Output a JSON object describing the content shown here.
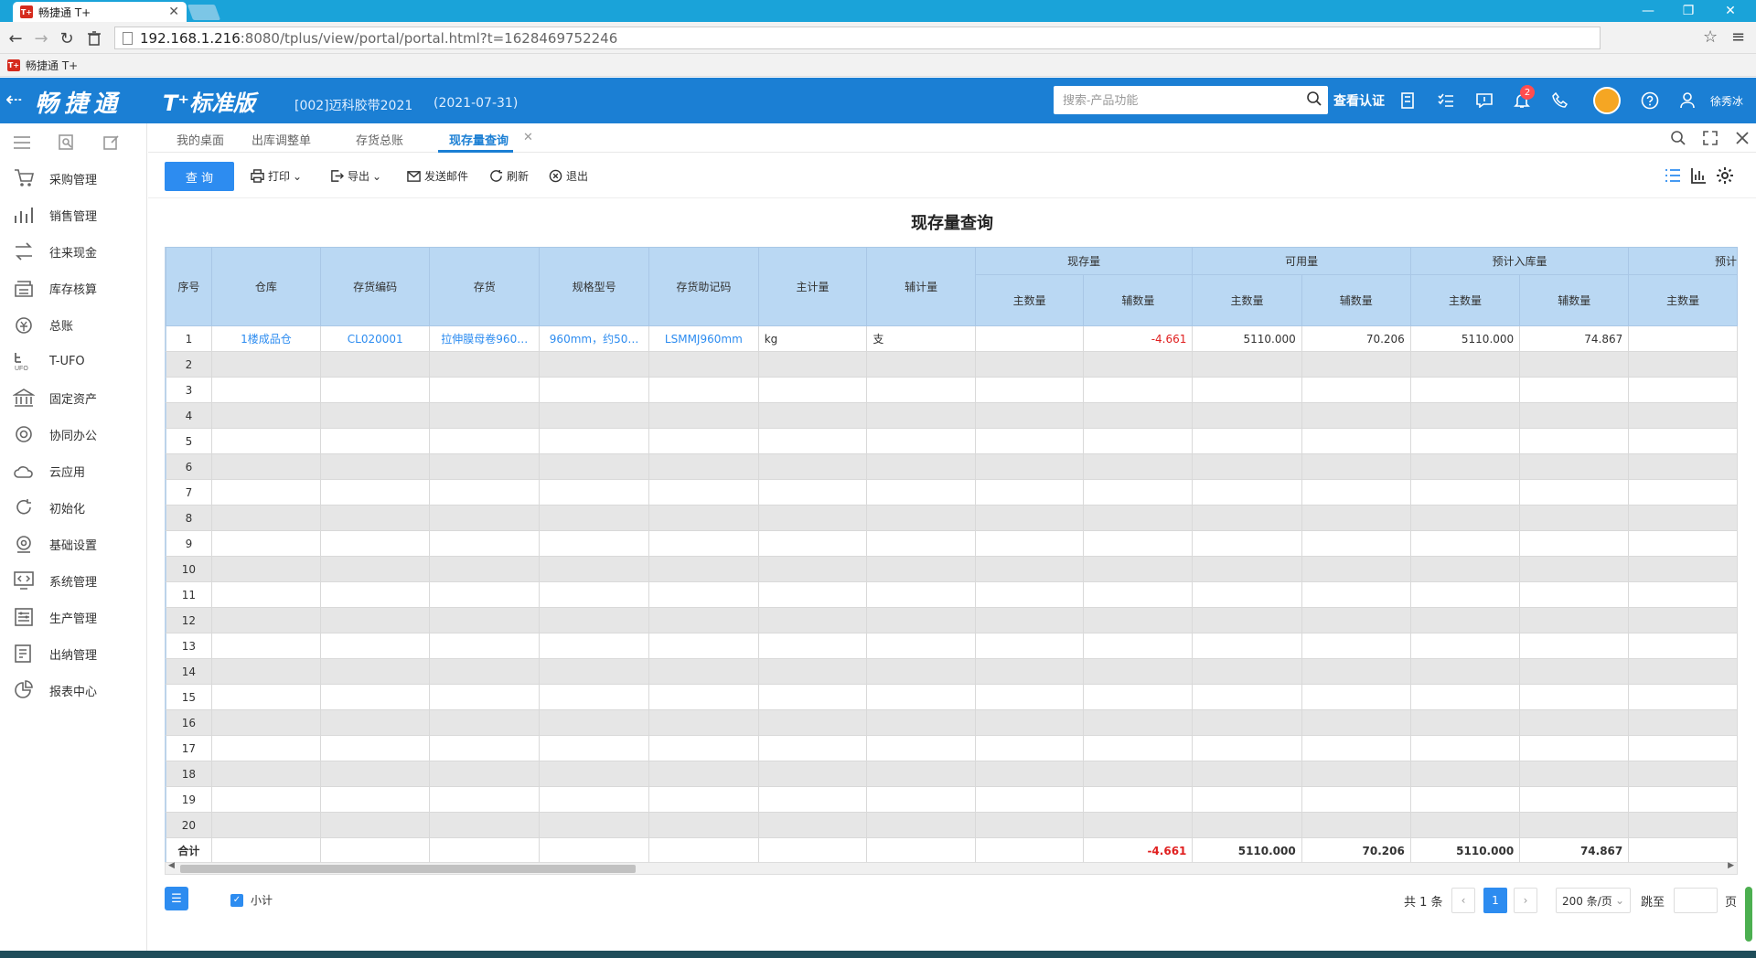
{
  "browser": {
    "tab_title": "畅捷通 T+",
    "tab_favicon": "T+",
    "url_host": "192.168.1.216",
    "url_rest": ":8080/tplus/view/portal/portal.html?t=1628469752246",
    "bookmark_label": "畅捷通 T+"
  },
  "header": {
    "brand": "畅捷通",
    "edition": "T⁺标准版",
    "company": "[002]迈科胶带2021",
    "date": "(2021-07-31)",
    "search_placeholder": "搜索-产品功能",
    "verify_label": "查看认证",
    "notif_count": "2",
    "username": "徐秀冰",
    "accent": "#1b7fd4"
  },
  "sidebar": {
    "items": [
      {
        "label": "采购管理",
        "icon": "purchase-icon"
      },
      {
        "label": "销售管理",
        "icon": "sales-chart-icon"
      },
      {
        "label": "往来现金",
        "icon": "transfer-icon"
      },
      {
        "label": "库存核算",
        "icon": "inventory-icon"
      },
      {
        "label": "总账",
        "icon": "ledger-icon"
      },
      {
        "label": "T-UFO",
        "icon": "ufo-icon"
      },
      {
        "label": "固定资产",
        "icon": "bank-icon"
      },
      {
        "label": "协同办公",
        "icon": "collab-icon"
      },
      {
        "label": "云应用",
        "icon": "cloud-icon"
      },
      {
        "label": "初始化",
        "icon": "refresh-icon"
      },
      {
        "label": "基础设置",
        "icon": "settings-icon"
      },
      {
        "label": "系统管理",
        "icon": "system-icon"
      },
      {
        "label": "生产管理",
        "icon": "production-icon"
      },
      {
        "label": "出纳管理",
        "icon": "cashier-icon"
      },
      {
        "label": "报表中心",
        "icon": "report-pie-icon"
      }
    ]
  },
  "tabs": [
    {
      "label": "我的桌面"
    },
    {
      "label": "出库调整单"
    },
    {
      "label": "存货总账"
    },
    {
      "label": "现存量查询"
    }
  ],
  "toolbar": {
    "query": "查 询",
    "print": "打印",
    "export": "导出",
    "email": "发送邮件",
    "refresh": "刷新",
    "exit": "退出"
  },
  "report": {
    "title": "现存量查询",
    "headers": {
      "index": "序号",
      "warehouse": "仓库",
      "code": "存货编码",
      "item": "存货",
      "spec": "规格型号",
      "mnemonic": "存货助记码",
      "main_unit": "主计量",
      "aux_unit": "辅计量",
      "groups": [
        "现存量",
        "可用量",
        "预计入库量",
        "预计"
      ],
      "main_qty": "主数量",
      "aux_qty": "辅数量"
    },
    "rows": [
      {
        "idx": "1",
        "warehouse": "1楼成品仓",
        "code": "CL020001",
        "item": "拉伸膜母卷960…",
        "spec": "960mm，约50…",
        "mnemonic": "LSMMJ960mm",
        "main_unit": "kg",
        "aux_unit": "支",
        "stock_main": "",
        "stock_aux": "-4.661",
        "avail_main": "5110.000",
        "avail_aux": "70.206",
        "in_main": "5110.000",
        "in_aux": "74.867",
        "next_main": ""
      }
    ],
    "empty_rows": [
      "2",
      "3",
      "4",
      "5",
      "6",
      "7",
      "8",
      "9",
      "10",
      "11",
      "12",
      "13",
      "14",
      "15",
      "16",
      "17",
      "18",
      "19",
      "20"
    ],
    "total": {
      "label": "合计",
      "stock_aux": "-4.661",
      "avail_main": "5110.000",
      "avail_aux": "70.206",
      "in_main": "5110.000",
      "in_aux": "74.867"
    }
  },
  "footer": {
    "subtotal_label": "小计",
    "count_text": "共 1 条",
    "current_page": "1",
    "page_size": "200 条/页",
    "jump_label": "跳至",
    "page_suffix": "页"
  }
}
